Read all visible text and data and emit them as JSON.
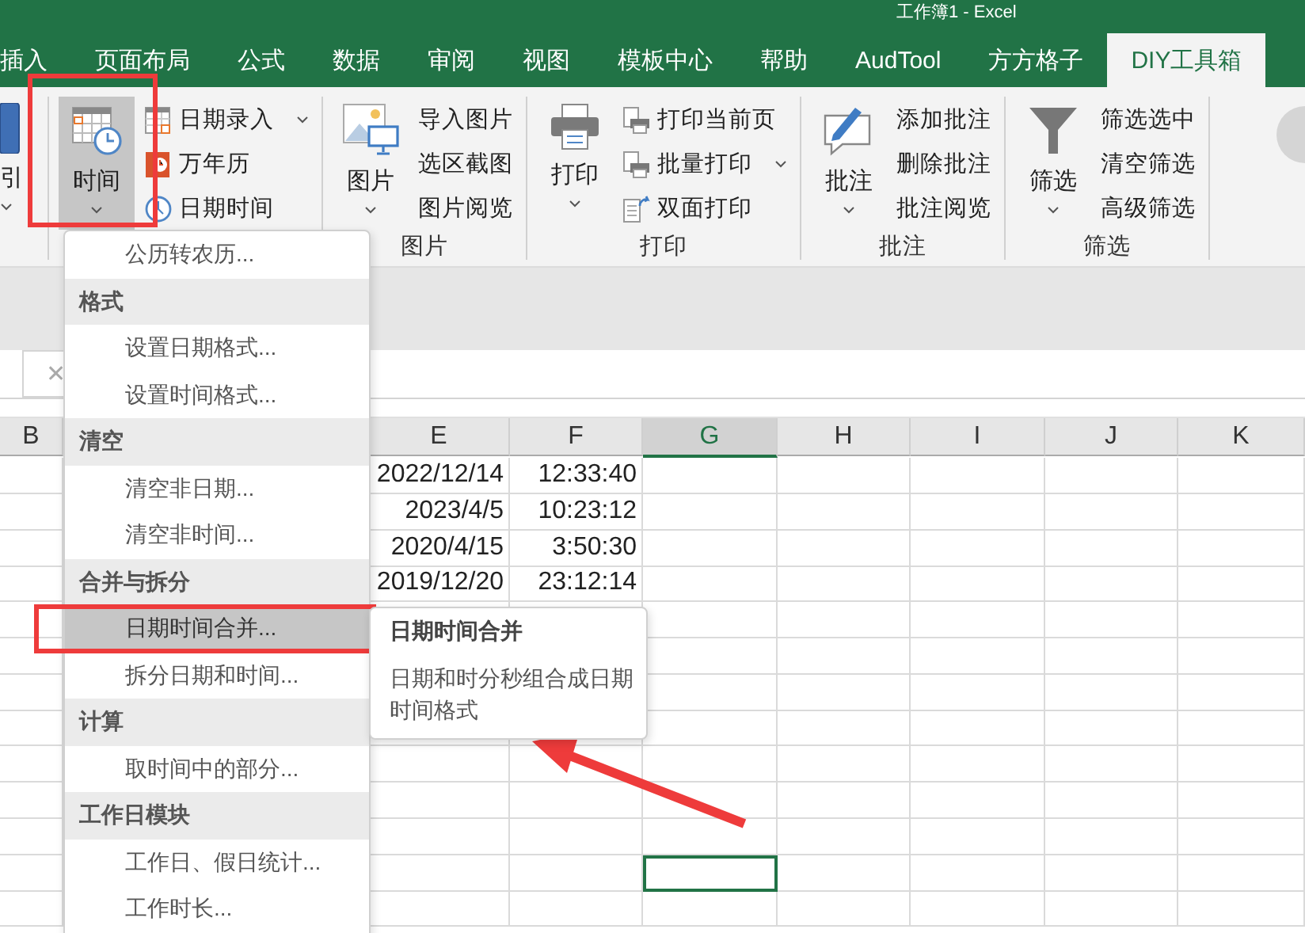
{
  "window": {
    "title": "工作簿1 - Excel"
  },
  "tabs": [
    {
      "label": "插入",
      "selected": false
    },
    {
      "label": "页面布局",
      "selected": false
    },
    {
      "label": "公式",
      "selected": false
    },
    {
      "label": "数据",
      "selected": false
    },
    {
      "label": "审阅",
      "selected": false
    },
    {
      "label": "视图",
      "selected": false
    },
    {
      "label": "模板中心",
      "selected": false
    },
    {
      "label": "帮助",
      "selected": false
    },
    {
      "label": "AudTool",
      "selected": false
    },
    {
      "label": "方方格子",
      "selected": false
    },
    {
      "label": "DIY工具箱",
      "selected": true
    }
  ],
  "ribbon": {
    "groups": [
      {
        "large": {
          "label": "引",
          "dropdown": true,
          "pressed": false
        }
      },
      {
        "large": {
          "label": "时间",
          "dropdown": true,
          "pressed": true
        },
        "small": [
          {
            "label": "日期录入",
            "dropdown": true
          },
          {
            "label": "万年历",
            "dropdown": false
          },
          {
            "label": "日期时间",
            "dropdown": false
          }
        ]
      },
      {
        "label": "图片",
        "large": {
          "label": "图片",
          "dropdown": true,
          "pressed": false
        },
        "small": [
          {
            "label": "导入图片",
            "dropdown": false
          },
          {
            "label": "选区截图",
            "dropdown": false
          },
          {
            "label": "图片阅览",
            "dropdown": false
          }
        ]
      },
      {
        "label": "打印",
        "large": {
          "label": "打印",
          "dropdown": true,
          "pressed": false
        },
        "small": [
          {
            "label": "打印当前页",
            "dropdown": false
          },
          {
            "label": "批量打印",
            "dropdown": true
          },
          {
            "label": "双面打印",
            "dropdown": false
          }
        ]
      },
      {
        "label": "批注",
        "large": {
          "label": "批注",
          "dropdown": true,
          "pressed": false
        },
        "small": [
          {
            "label": "添加批注",
            "dropdown": false
          },
          {
            "label": "删除批注",
            "dropdown": false
          },
          {
            "label": "批注阅览",
            "dropdown": false
          }
        ]
      },
      {
        "label": "筛选",
        "large": {
          "label": "筛选",
          "dropdown": true,
          "pressed": false
        },
        "small": [
          {
            "label": "筛选选中",
            "dropdown": false
          },
          {
            "label": "清空筛选",
            "dropdown": false
          },
          {
            "label": "高级筛选",
            "dropdown": false
          }
        ]
      }
    ]
  },
  "formula_bar": {
    "cancel_glyph": "✕"
  },
  "sheet": {
    "columns": [
      {
        "label": "B",
        "selected": false
      },
      {
        "label": "E",
        "selected": false
      },
      {
        "label": "F",
        "selected": false
      },
      {
        "label": "G",
        "selected": true
      },
      {
        "label": "H",
        "selected": false
      },
      {
        "label": "I",
        "selected": false
      },
      {
        "label": "J",
        "selected": false
      },
      {
        "label": "K",
        "selected": false
      }
    ],
    "rows": [
      {
        "cells": [
          "2022/12/14",
          "12:33:40"
        ],
        "selected": false
      },
      {
        "cells": [
          "2023/4/5",
          "10:23:12"
        ],
        "selected": false
      },
      {
        "cells": [
          "2020/4/15",
          "3:50:30"
        ],
        "selected": false
      },
      {
        "cells": [
          "2019/12/20",
          "23:12:14"
        ],
        "selected": false
      },
      {
        "selected": false
      },
      {
        "selected": false
      },
      {
        "selected": false
      },
      {
        "selected": false
      },
      {
        "selected": false
      },
      {
        "selected": false
      },
      {
        "selected": false
      },
      {
        "selected": true
      },
      {
        "selected": false
      }
    ]
  },
  "menu": {
    "items": [
      {
        "kind": "item",
        "label": "公历转农历...",
        "selected": false
      },
      {
        "kind": "header",
        "label": "格式"
      },
      {
        "kind": "item",
        "label": "设置日期格式...",
        "selected": false
      },
      {
        "kind": "item",
        "label": "设置时间格式...",
        "selected": false
      },
      {
        "kind": "header",
        "label": "清空"
      },
      {
        "kind": "item",
        "label": "清空非日期...",
        "selected": false
      },
      {
        "kind": "item",
        "label": "清空非时间...",
        "selected": false
      },
      {
        "kind": "header",
        "label": "合并与拆分"
      },
      {
        "kind": "item",
        "label": "日期时间合并...",
        "selected": true
      },
      {
        "kind": "item",
        "label": "拆分日期和时间...",
        "selected": false
      },
      {
        "kind": "header",
        "label": "计算"
      },
      {
        "kind": "item",
        "label": "取时间中的部分...",
        "selected": false
      },
      {
        "kind": "header",
        "label": "工作日模块"
      },
      {
        "kind": "item",
        "label": "工作日、假日统计...",
        "selected": false
      },
      {
        "kind": "item",
        "label": "工作时长...",
        "selected": false
      }
    ]
  },
  "tooltip": {
    "title": "日期时间合并",
    "text": "日期和时分秒组合成日期时间格式"
  }
}
